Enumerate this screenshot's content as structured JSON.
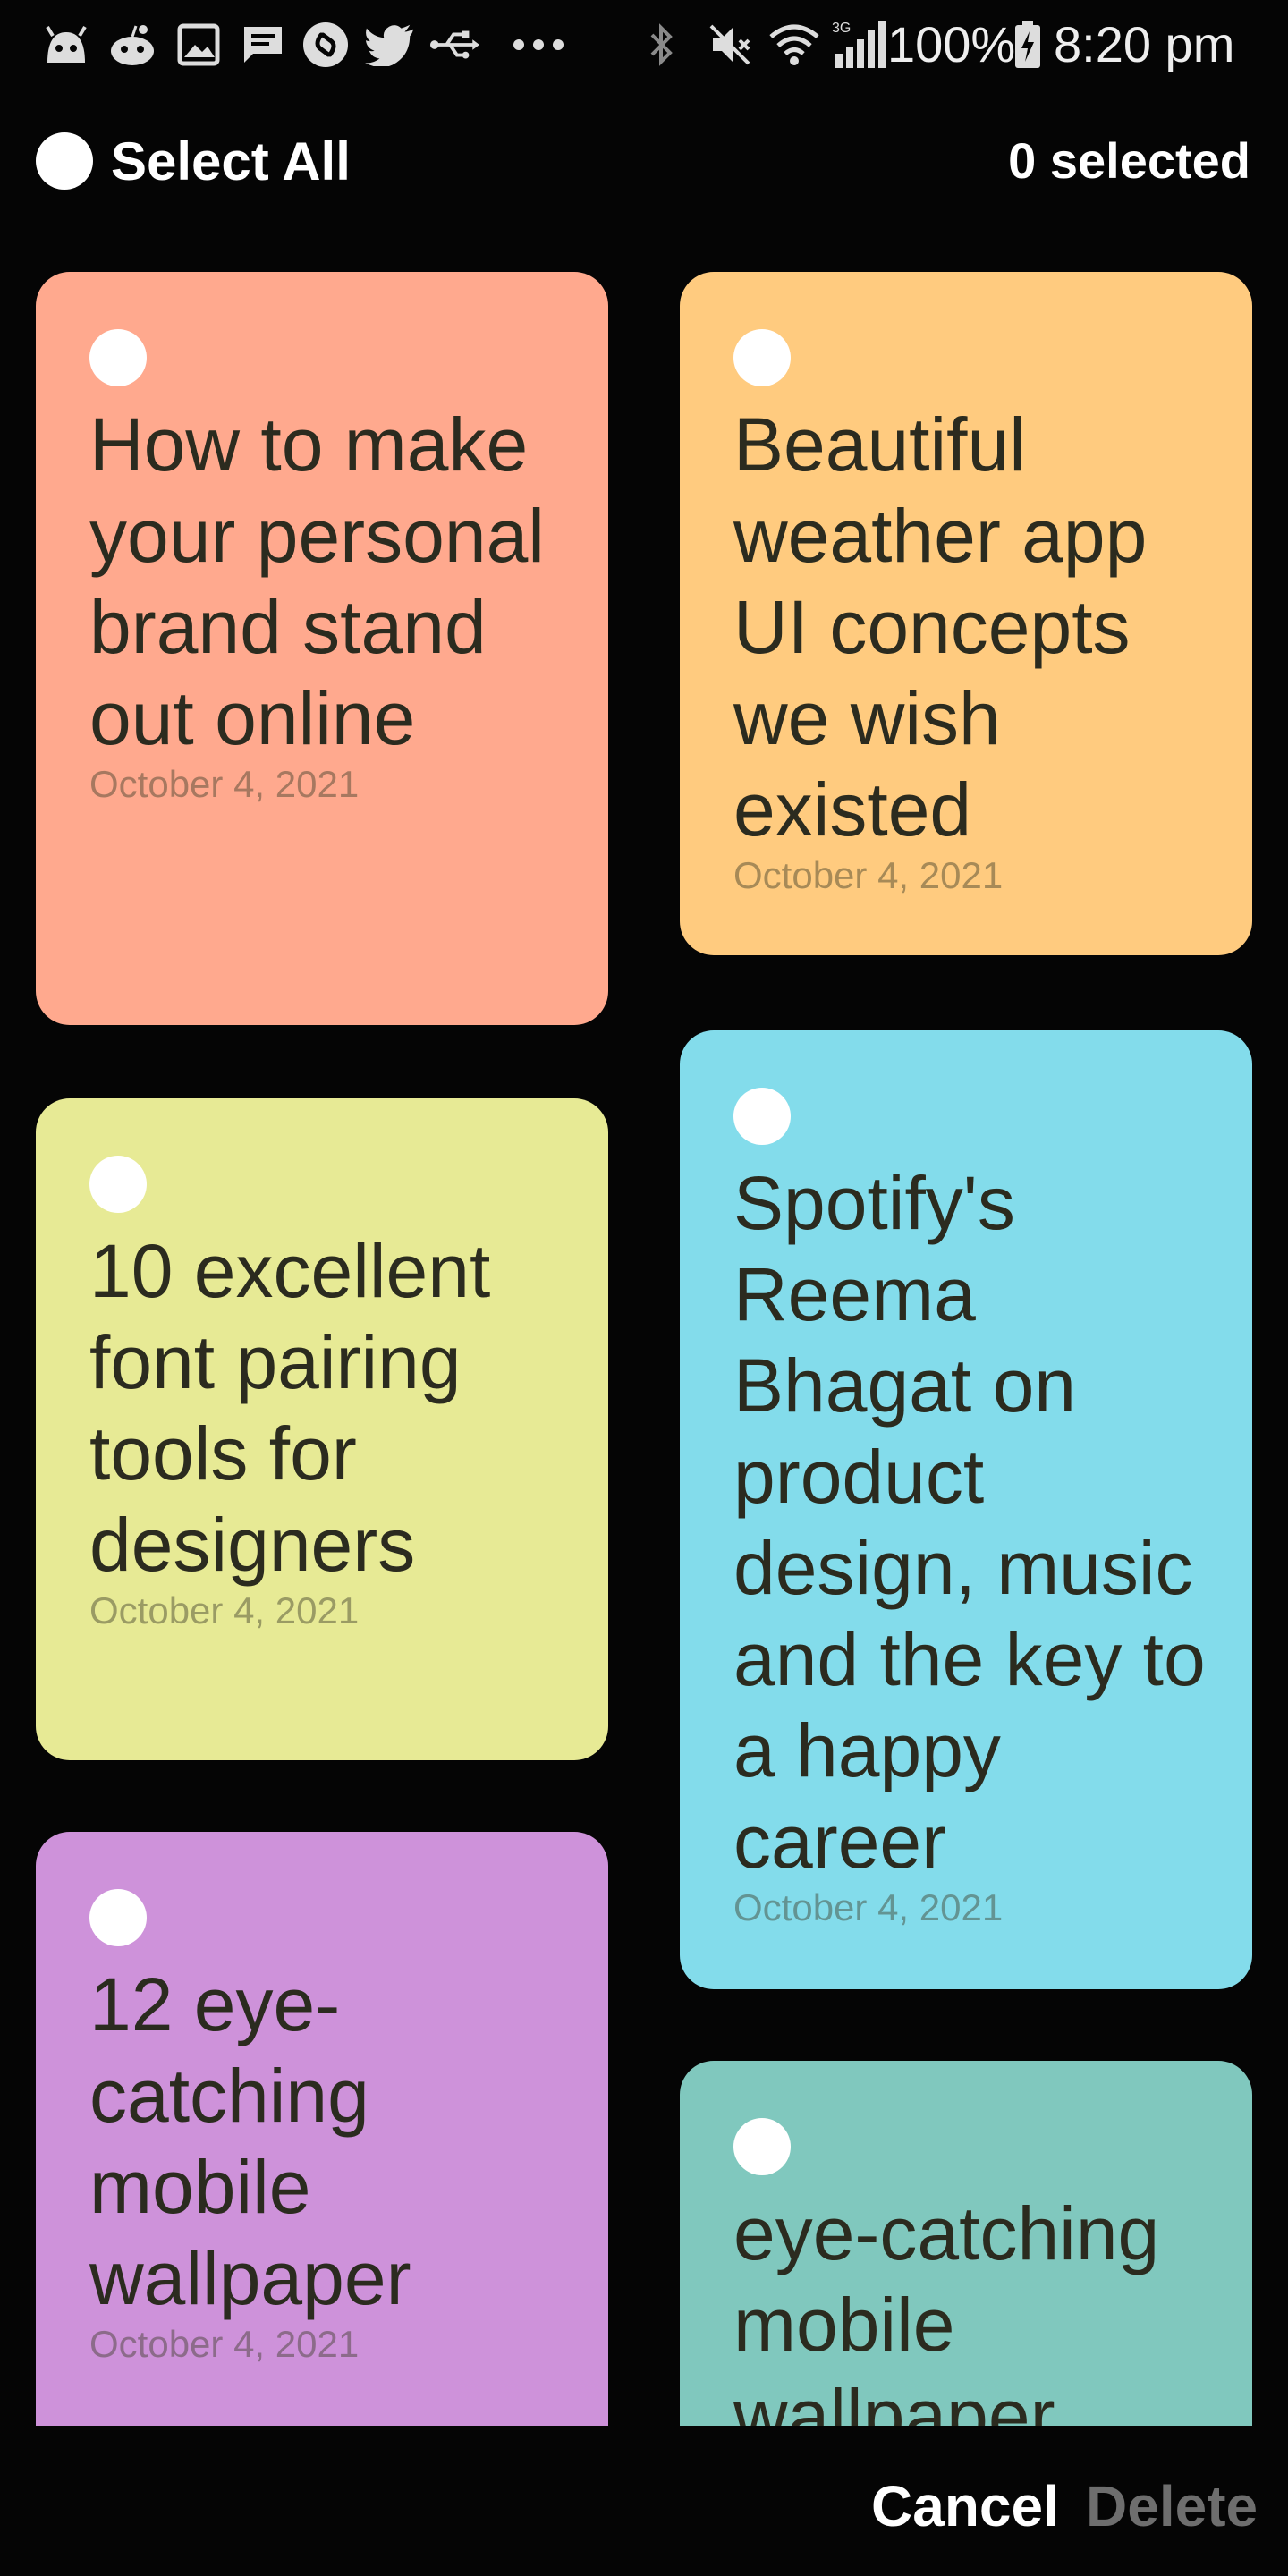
{
  "status_bar": {
    "left_icons": [
      "android-head-icon",
      "reddit-icon",
      "image-icon",
      "message-icon",
      "shazam-icon",
      "twitter-icon",
      "usb-icon",
      "more-dots-icon"
    ],
    "network_label": "3G",
    "battery": "100%",
    "time": "8:20 pm"
  },
  "header": {
    "select_all_label": "Select All",
    "selected_count": "0 selected"
  },
  "notes": [
    {
      "title": "How to make your personal brand stand out online",
      "date": "October 4, 2021",
      "color": "#FFA98E"
    },
    {
      "title": "Beautiful weather app UI concepts we wish existed",
      "date": "October 4, 2021",
      "color": "#FFCB7F"
    },
    {
      "title": "10 excellent font pairing tools for designers",
      "date": "October 4, 2021",
      "color": "#E7EA95"
    },
    {
      "title": "Spotify's Reema Bhagat on product design, music and the key to a happy career",
      "date": "October 4, 2021",
      "color": "#83DCEB"
    },
    {
      "title": "12 eye-catching mobile wallpaper",
      "date": "October 4, 2021",
      "color": "#CE92DA"
    },
    {
      "title": "eye-catching mobile wallpaper",
      "date": "",
      "color": "#80C8BE"
    }
  ],
  "actions": {
    "cancel_label": "Cancel",
    "delete_label": "Delete",
    "cancel_color": "#FFFFFF",
    "delete_color": "#6E6E6E"
  }
}
